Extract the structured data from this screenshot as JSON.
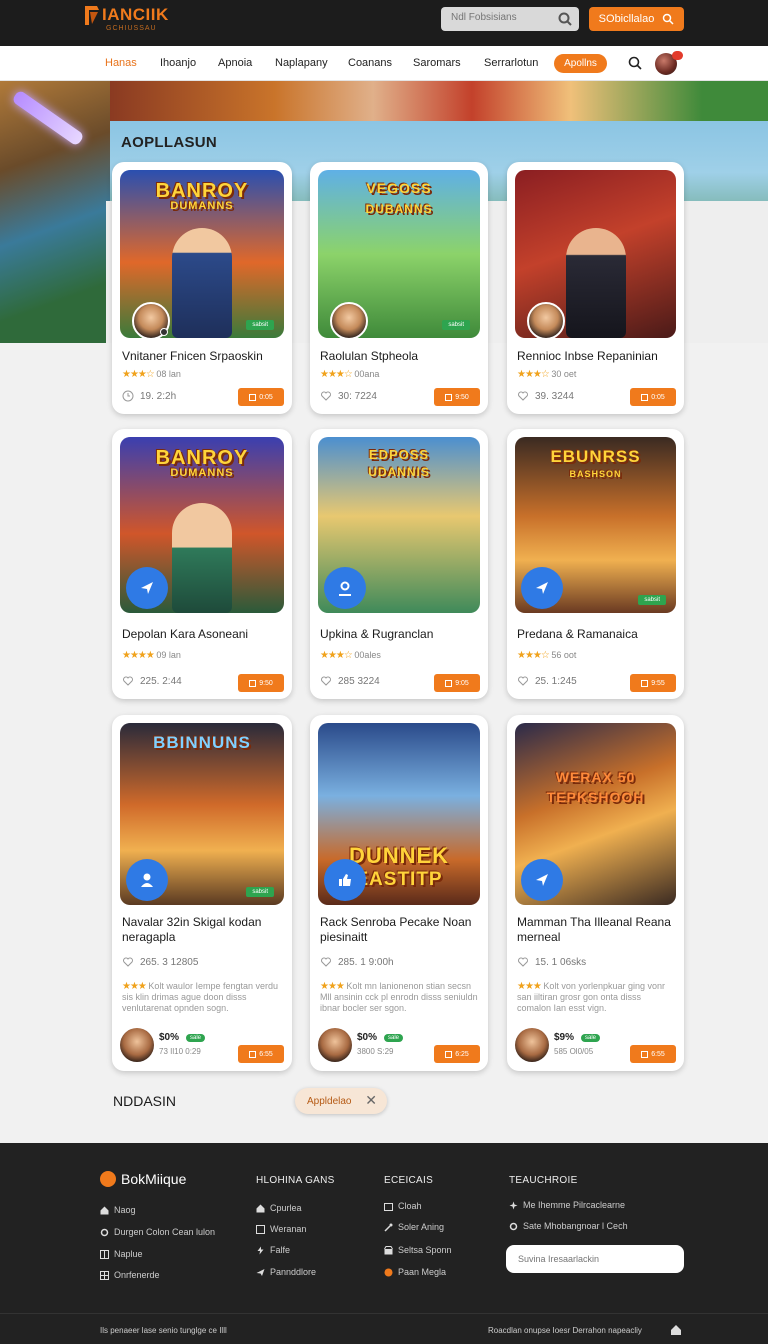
{
  "header": {
    "logo_text": "IANCIIK",
    "logo_sub": "GCHIUSSAU",
    "search_placeholder": "Ndl Fobsisians",
    "top_button": "SObicllalao"
  },
  "nav": {
    "items": [
      "Hanas",
      "Ihoanjo",
      "Apnoia",
      "Naplapany",
      "Coanans",
      "Saromars",
      "Serrarlotun"
    ],
    "pill": "Apollns",
    "brand_color": "#f07a1c"
  },
  "section_title": "AOPLLASUN",
  "cards": [
    {
      "art": "BANROY",
      "art_sub": "DUMANNS",
      "badge": "sabsit",
      "title": "Vnitaner Fnicen Srpaoskin",
      "rating_text": "08 lan",
      "meta": "19. 2:2h",
      "action": "0:05"
    },
    {
      "art": "VEGOSS",
      "art_sub": "DUBANNS",
      "badge": "sabsit",
      "title": "Raolulan Stpheola",
      "rating_text": "00ana",
      "meta": "30: 7224",
      "action": "9:50"
    },
    {
      "art": "",
      "art_sub": "",
      "badge": "",
      "title": "Rennioc Inbse Repaninian",
      "rating_text": "30 oet",
      "meta": "39. 3244",
      "action": "0:05"
    },
    {
      "art": "BANROY",
      "art_sub": "DUMANNS",
      "badge": "",
      "title": "Depolan Kara Asoneani",
      "rating_text": "09 lan",
      "meta": "225. 2:44",
      "action": "9:50"
    },
    {
      "art": "EDPOSS",
      "art_sub": "UDANNIS",
      "badge": "",
      "title": "Upkina & Rugranclan",
      "rating_text": "00ales",
      "meta": "285 3224",
      "action": "9:05"
    },
    {
      "art": "EBUNRSS",
      "art_sub": "BASHSON",
      "badge": "sabsit",
      "title": "Predana & Ramanaica",
      "rating_text": "56 oot",
      "meta": "25. 1:245",
      "action": "9:55"
    },
    {
      "art": "BBINNUNS",
      "art_sub": "",
      "badge": "sabsit",
      "title": "Navalar 32in Skigal kodan neragapla",
      "meta": "265. 3 12805",
      "desc": "Kolt waulor Iempe fengtan verdu sis klin drimas ague doon disss venlutarenat opnden sogn.",
      "price": "$0%",
      "price_tag": "sale",
      "price_sub": "73 Il10 0:29",
      "action": "6:55"
    },
    {
      "art": "DUNNEK",
      "art_sub": "EASTITP",
      "badge": "",
      "title": "Rack Senroba Pecake Noan piesinaitt",
      "meta": "285. 1 9:00h",
      "desc": "Kolt mn lanionenon stian secsn Mll ansinin cck pl enrodn disss seniuldn ibnar bocler ser sgon.",
      "price": "$0%",
      "price_tag": "sale",
      "price_sub": "3800 S:29",
      "action": "6:25"
    },
    {
      "art": "WERAX 50",
      "art_sub": "TEPKSHOOH",
      "badge": "",
      "title": "Mamman Tha Illeanal Reana merneal",
      "meta": "15. 1 06sks",
      "desc": "Kolt von yorlenpkuar ging vonr san iiltiran grosr gon onta disss comalon Ian esst vign.",
      "price": "$9%",
      "price_tag": "sale",
      "price_sub": "585 Ol0/05",
      "action": "6:55"
    }
  ],
  "bottom": {
    "heading": "NDDASIN",
    "chip_label": "Appldelao"
  },
  "footer": {
    "brand": "BokMiique",
    "col1": [
      "Naog",
      "Durgen Colon Cean lulon",
      "Naplue",
      "Onrfenerde"
    ],
    "col2_head": "HLOHINA GANS",
    "col2": [
      "Cpurlea",
      "Weranan",
      "Falfe",
      "Pannddlore"
    ],
    "col3_head": "ECEICAIS",
    "col3": [
      "Cloah",
      "Soler Aning",
      "Seltsa Sponn",
      "Paan Megla"
    ],
    "col4_head": "TEAUCHROIE",
    "col4": [
      "Me Ihemme Pilrcaclearne",
      "Sate Mhobangnoar l Cech"
    ],
    "subscribe_placeholder": "Suvina Iresaarlackin",
    "bottom_left": "Ils penaeer lase senio tunglge ce Illl",
    "bottom_right": "Roacdlan onupse Ioesr Derrahon napeacliy"
  }
}
